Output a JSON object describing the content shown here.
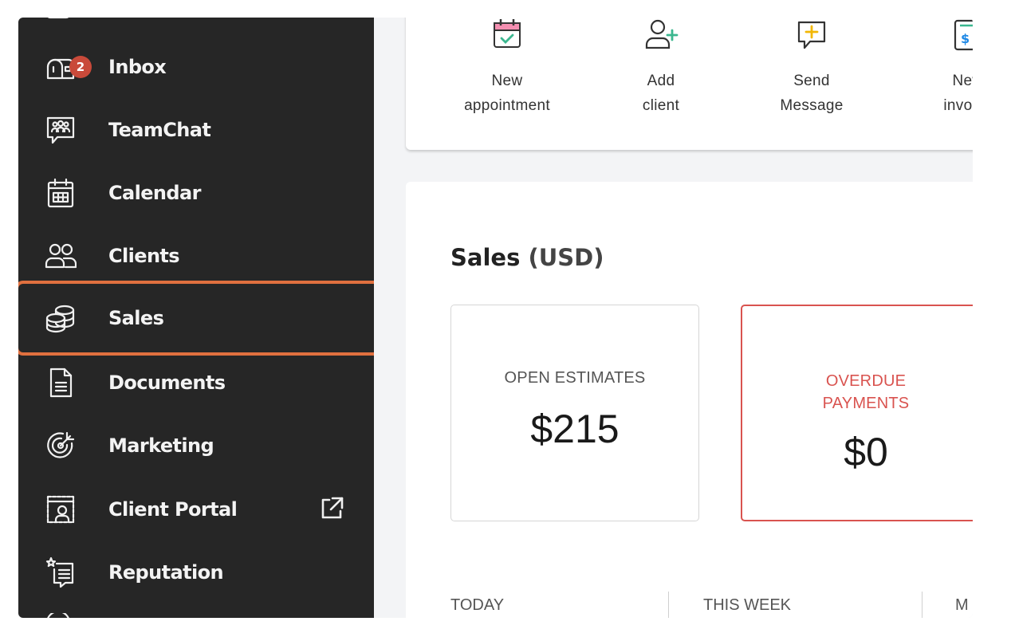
{
  "sidebar": {
    "items": [
      {
        "label": "Inbox",
        "icon": "inbox-icon",
        "badge": "2"
      },
      {
        "label": "TeamChat",
        "icon": "teamchat-icon"
      },
      {
        "label": "Calendar",
        "icon": "calendar-icon"
      },
      {
        "label": "Clients",
        "icon": "clients-icon"
      },
      {
        "label": "Sales",
        "icon": "coins-icon",
        "active": true
      },
      {
        "label": "Documents",
        "icon": "document-icon"
      },
      {
        "label": "Marketing",
        "icon": "target-icon"
      },
      {
        "label": "Client Portal",
        "icon": "portal-icon",
        "external": "external-link-icon"
      },
      {
        "label": "Reputation",
        "icon": "reputation-icon"
      }
    ]
  },
  "quick_actions": [
    {
      "label_line1": "New",
      "label_line2": "appointment",
      "icon": "new-appointment-icon"
    },
    {
      "label_line1": "Add",
      "label_line2": "client",
      "icon": "add-client-icon"
    },
    {
      "label_line1": "Send",
      "label_line2": "Message",
      "icon": "send-message-icon"
    },
    {
      "label_line1": "New",
      "label_line2": "invoice",
      "icon": "new-invoice-icon"
    }
  ],
  "sales": {
    "title": "Sales",
    "unit": "(USD)",
    "open_estimates": {
      "label": "OPEN ESTIMATES",
      "value": "$215"
    },
    "overdue_payments": {
      "label_line1": "OVERDUE",
      "label_line2": "PAYMENTS",
      "value": "$0"
    },
    "periods": [
      "TODAY",
      "THIS WEEK",
      "M"
    ]
  },
  "colors": {
    "sidebar_bg": "#262626",
    "active_outline": "#e0703f",
    "overdue": "#d9534f",
    "badge": "#c94a3a"
  }
}
